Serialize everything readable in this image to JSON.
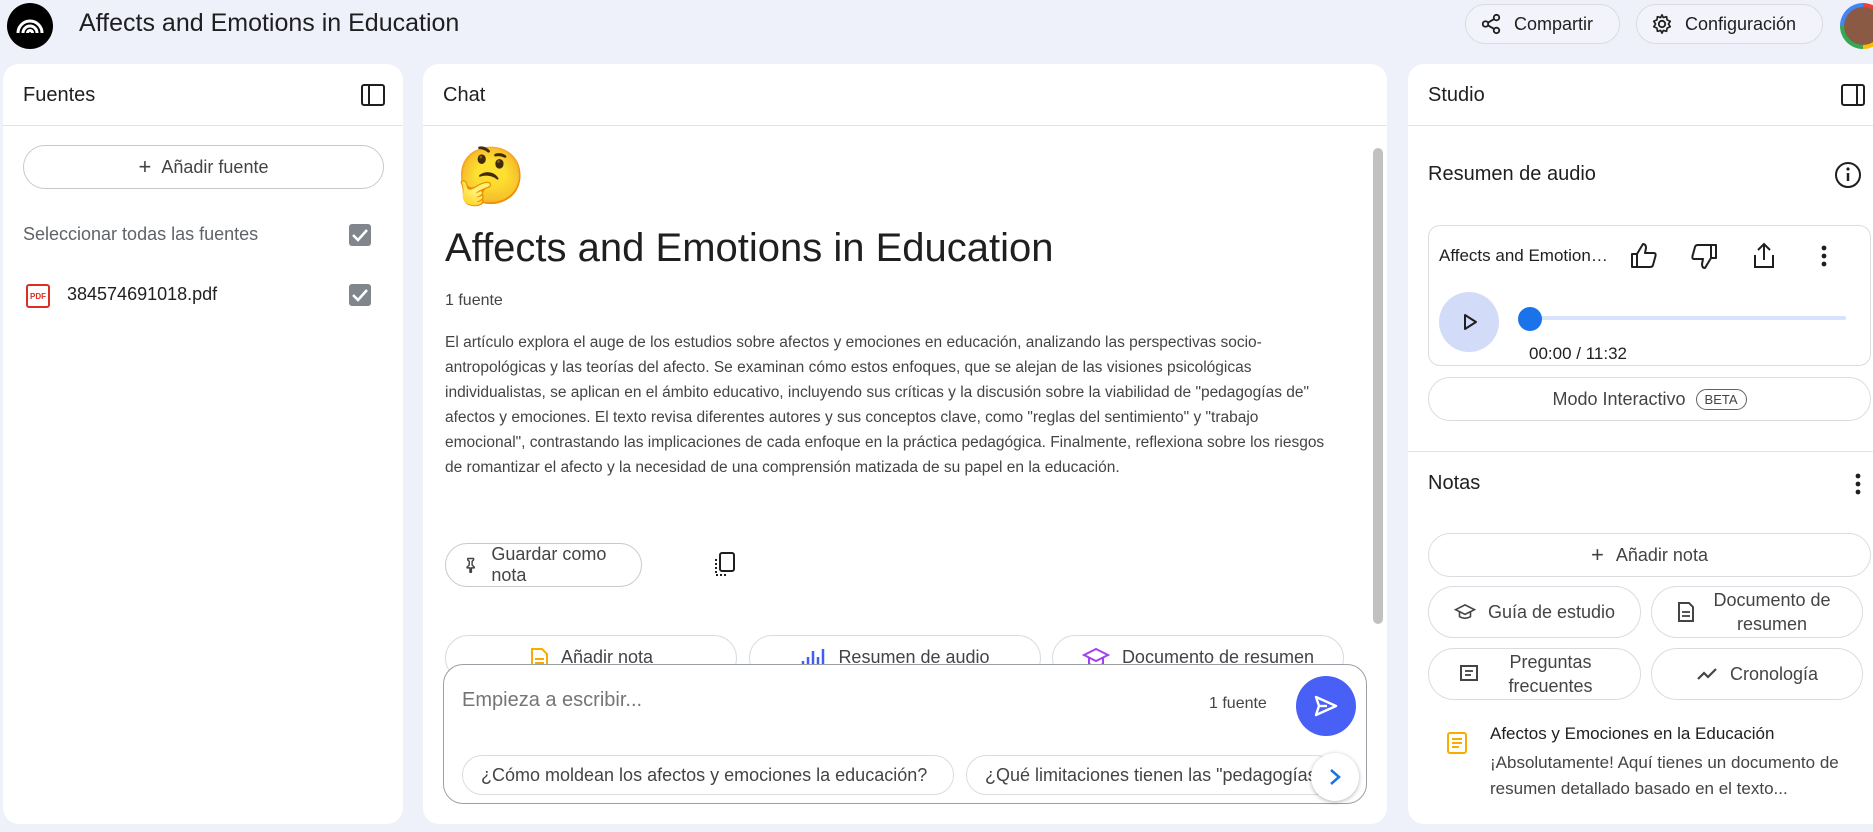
{
  "header": {
    "app_title": "Affects and Emotions in Education",
    "share_label": "Compartir",
    "config_label": "Configuración"
  },
  "sources": {
    "title": "Fuentes",
    "add_label": "Añadir fuente",
    "select_all_label": "Seleccionar todas las fuentes",
    "items": [
      {
        "name": "384574691018.pdf",
        "icon": "pdf-icon",
        "icon_text": "PDF",
        "checked": true
      }
    ]
  },
  "chat": {
    "title": "Chat",
    "emoji": "🤔",
    "notebook_title": "Affects and Emotions in Education",
    "source_count": "1 fuente",
    "summary": "El artículo explora el auge de los estudios sobre afectos y emociones en educación, analizando las perspectivas socio-antropológicas y las teorías del afecto. Se examinan cómo estos enfoques, que se alejan de las visiones psicológicas individualistas, se aplican en el ámbito educativo, incluyendo sus críticas y la discusión sobre la viabilidad de \"pedagogías de\" afectos y emociones. El texto revisa diferentes autores y sus conceptos clave, como \"reglas del sentimiento\" y \"trabajo emocional\", contrastando las implicaciones de cada enfoque en la práctica pedagógica. Finalmente, reflexiona sobre los riesgos de romantizar el afecto y la necesidad de una comprensión matizada de su papel en la educación.",
    "save_note_label": "Guardar como nota",
    "chips": [
      "Añadir nota",
      "Resumen de audio",
      "Documento de resumen"
    ],
    "input_placeholder": "Empieza a escribir...",
    "input_source_count": "1 fuente",
    "suggestions": [
      "¿Cómo moldean los afectos y emociones la educación?",
      "¿Qué limitaciones tienen las \"pedagogías"
    ]
  },
  "studio": {
    "title": "Studio",
    "audio_section_title": "Resumen de audio",
    "audio_name": "Affects and Emotions in Education",
    "audio_time": "00:00 / 11:32",
    "audio_progress": 0,
    "interactive_label": "Modo Interactivo",
    "beta_label": "BETA",
    "notes_title": "Notas",
    "add_note_label": "Añadir nota",
    "buttons": {
      "study_guide": "Guía de estudio",
      "summary_doc": "Documento de resumen",
      "faq": "Preguntas frecuentes",
      "timeline": "Cronología"
    },
    "note": {
      "title": "Afectos y Emociones en la Educación",
      "snippet": "¡Absolutamente! Aquí tienes un documento de resumen detallado basado en el texto..."
    }
  },
  "colors": {
    "accent": "#4860f6",
    "background": "#eef0fa",
    "pdf": "#d93025"
  }
}
